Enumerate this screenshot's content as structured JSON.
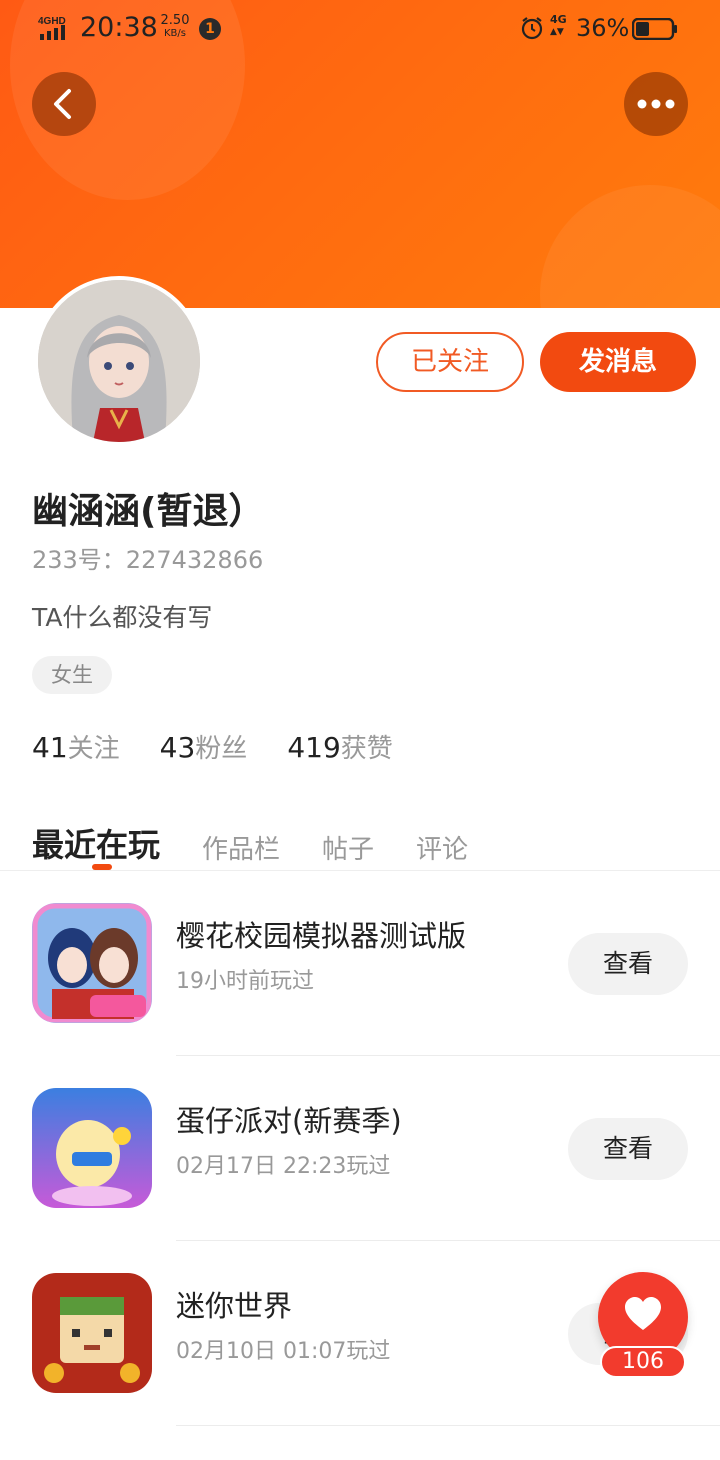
{
  "statusbar": {
    "network": "4GHD",
    "time": "20:38",
    "speed_value": "2.50",
    "speed_unit": "KB/s",
    "notification_count": "1",
    "network_type": "4G",
    "battery": "36%"
  },
  "profile": {
    "username": "幽涵涵(暂退）",
    "id_line": "233号：227432866",
    "bio": "TA什么都没有写",
    "gender": "女生",
    "follow_button": "已关注",
    "message_button": "发消息"
  },
  "stats": [
    {
      "value": "41",
      "label": "关注"
    },
    {
      "value": "43",
      "label": "粉丝"
    },
    {
      "value": "419",
      "label": "获赞"
    }
  ],
  "tabs": [
    "最近在玩",
    "作品栏",
    "帖子",
    "评论"
  ],
  "games": [
    {
      "name": "樱花校园模拟器测试版",
      "time": "19小时前玩过",
      "button": "查看",
      "icon": "sakura-school-icon"
    },
    {
      "name": "蛋仔派对(新赛季)",
      "time": "02月17日 22:23玩过",
      "button": "查看",
      "icon": "eggy-party-icon"
    },
    {
      "name": "迷你世界",
      "time": "02月10日 01:07玩过",
      "button": "查看",
      "icon": "mini-world-icon"
    }
  ],
  "like_float": {
    "count": "106"
  },
  "colors": {
    "accent": "#f24a10",
    "header": "#ff6a10",
    "like": "#f23b2d"
  }
}
